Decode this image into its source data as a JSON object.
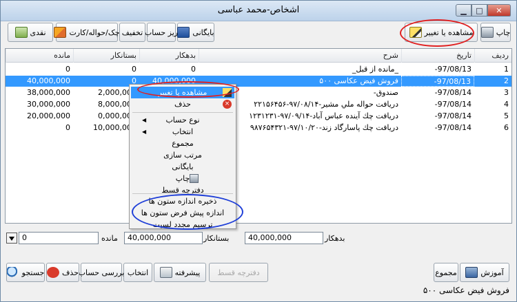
{
  "window": {
    "title": "اشخاص-محمد عباسی",
    "minimize_glyph": "▁",
    "maximize_glyph": "□",
    "close_glyph": "✕"
  },
  "toolbar_top": {
    "print_label": "چاپ",
    "view_edit_label": "مشاهده یا تغییر",
    "archive_label": "بایگانی",
    "detail_account_label": "ریز حساب",
    "discount_label": "تخفیف",
    "check_transfer_card_label": "چک/حواله/کارت",
    "cash_label": "نقدی"
  },
  "grid": {
    "columns": [
      "ردیف",
      "تاریخ",
      "شرح",
      "بدهکار",
      "بستانکار",
      "مانده"
    ],
    "rows": [
      {
        "row": "1",
        "date": "97/08/13-",
        "description": "_مانده از قبل_",
        "debit": "0",
        "credit": "0",
        "balance": "0"
      },
      {
        "row": "2",
        "date": "97/08/13-",
        "description": "فروش فیض عکاسی ۵۰۰",
        "debit": "40,000,000",
        "credit": "0",
        "balance": "40,000,000"
      },
      {
        "row": "3",
        "date": "97/08/14-",
        "description": "صندوق-",
        "debit": "",
        "credit": "2,000,000",
        "balance": "38,000,000"
      },
      {
        "row": "4",
        "date": "97/08/14-",
        "description": "دریافت حواله ملي مشیر-۹۷/۰۸/۱۴-۲۲۱۵۶۴۵۶",
        "debit": "",
        "credit": "8,000,000",
        "balance": "30,000,000"
      },
      {
        "row": "5",
        "date": "97/08/14-",
        "description": "دریافت چك آینده عباس آباد-۹۷/۰۹/۱۴-۱۲۳۱۲۳۱",
        "debit": "",
        "credit": "0,000,000",
        "balance": "20,000,000"
      },
      {
        "row": "6",
        "date": "97/08/14-",
        "description": "دریافت چك پاسارگاد زند-۹۷/۱۰/۲۰-۹۸۷۶۵۴۳۲۱",
        "debit": "",
        "credit": "10,000,000",
        "balance": "0"
      }
    ]
  },
  "context_menu": {
    "view_edit": "مشاهده یا تغییر",
    "delete": "حذف",
    "account_type": "نوع حساب",
    "select": "انتخاب",
    "total": "مجموع",
    "sort": "مرتب سازی",
    "archive": "بایگانی",
    "print": "چاپ",
    "installment_book": "دفترچه قسط",
    "save_column_sizes": "ذخیره اندازه ستون ها",
    "default_column_sizes": "اندازه پیش فرض ستون ها",
    "redraw_list": "ترسیم مجدد لسیت"
  },
  "totals": {
    "debit_label": "بدهکار",
    "debit_value": "40,000,000",
    "credit_label": "بستانکار",
    "credit_value": "40,000,000",
    "balance_label": "مانده",
    "balance_value": "0"
  },
  "toolbar_bottom": {
    "tutorial_label": "آموزش",
    "total_label": "مجموع",
    "installment_book_label": "دفترچه قسط",
    "advanced_label": "پیشرفته",
    "select_label": "انتخاب",
    "account_review_label": "بررسی حساب",
    "delete_label": "حذف",
    "search_label": "جستجو"
  },
  "status": {
    "selected_text": "فروش فیض عکاسی ۵۰۰"
  }
}
